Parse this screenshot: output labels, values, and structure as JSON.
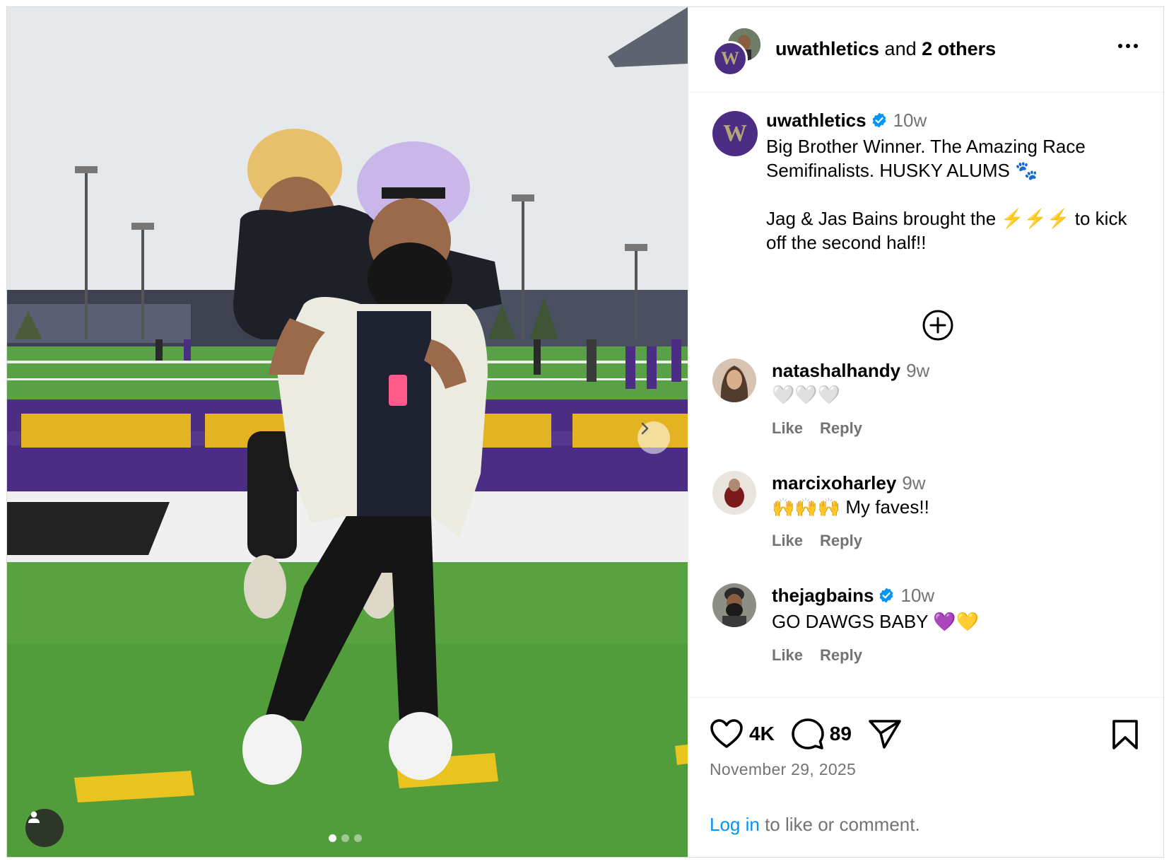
{
  "header": {
    "username": "uwathletics",
    "others_text": " and ",
    "others_count": "2 others"
  },
  "logo_letter": "W",
  "caption": {
    "username": "uwathletics",
    "time": "10w",
    "line1": "Big Brother Winner. The Amazing Race Semifinalists. HUSKY ALUMS 🐾",
    "line2": "Jag & Jas Bains brought the ⚡⚡⚡ to kick off the second half!!"
  },
  "comments": [
    {
      "username": "natashalhandy",
      "time": "9w",
      "text": "🤍🤍🤍",
      "like": "Like",
      "reply": "Reply",
      "verified": false
    },
    {
      "username": "marcixoharley",
      "time": "9w",
      "text": "🙌🙌🙌 My faves!!",
      "like": "Like",
      "reply": "Reply",
      "verified": false
    },
    {
      "username": "thejagbains",
      "time": "10w",
      "text": "GO DAWGS BABY 💜💛",
      "like": "Like",
      "reply": "Reply",
      "verified": true
    }
  ],
  "stats": {
    "likes": "4K",
    "comments": "89"
  },
  "date": "November 29, 2025",
  "login": {
    "link": "Log in",
    "text": " to like or comment."
  },
  "colors": {
    "uw_purple": "#4b2e83",
    "uw_gold": "#b7a57a",
    "link_blue": "#0095f6",
    "verified_blue": "#0095f6",
    "muted": "#737373"
  }
}
